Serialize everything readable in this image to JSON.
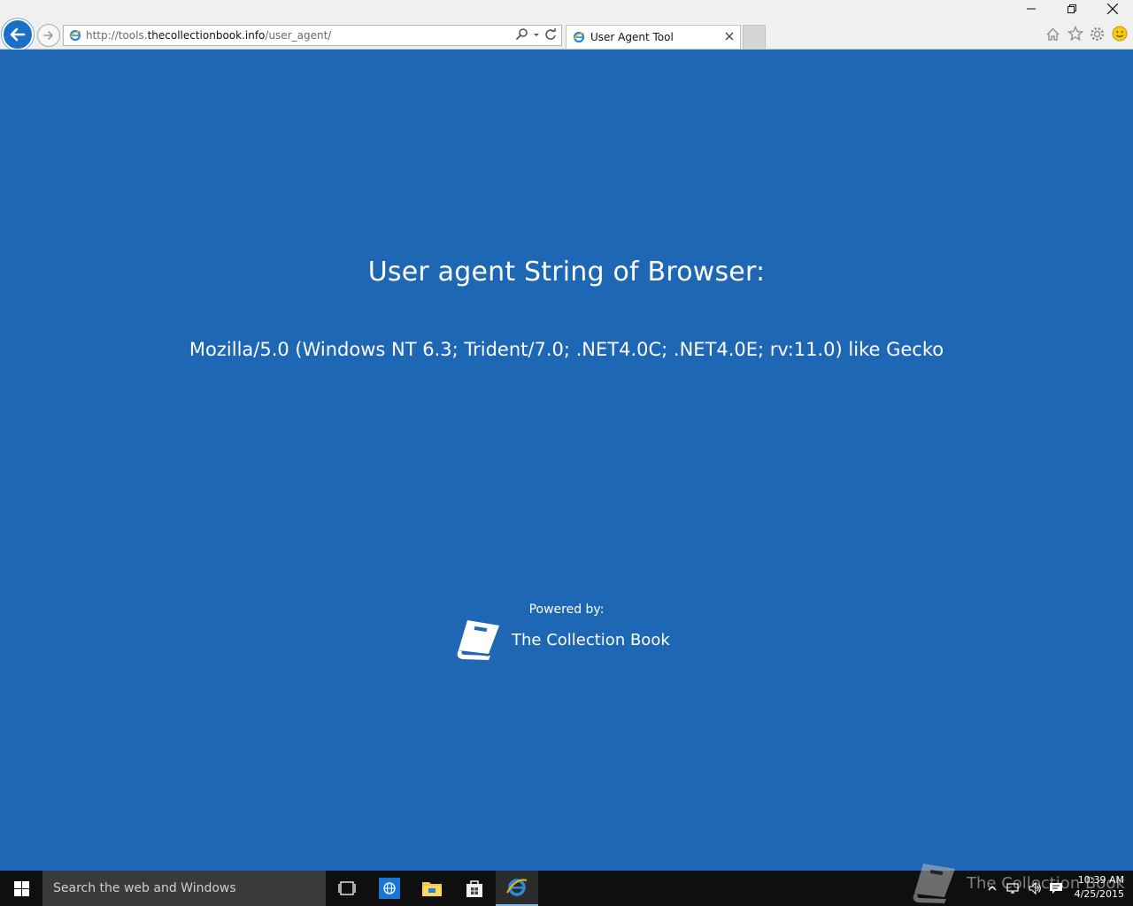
{
  "browser": {
    "address": {
      "protocol": "http://tools.",
      "domain": "thecollectionbook.info",
      "path": "/user_agent/"
    },
    "tab": {
      "title": "User Agent Tool"
    }
  },
  "page": {
    "heading": "User agent String of Browser:",
    "user_agent": "Mozilla/5.0 (Windows NT 6.3; Trident/7.0; .NET4.0C; .NET4.0E; rv:11.0) like Gecko",
    "powered_label": "Powered by:",
    "brand_name": "The Collection Book"
  },
  "taskbar": {
    "search_placeholder": "Search the web and Windows",
    "watermark": "The Collection Book",
    "time": "10:39 AM",
    "date": "4/25/2015"
  },
  "colors": {
    "page_background": "#1e67b4",
    "taskbar": "#0f0f0f",
    "ie_blue": "#1b6fc7"
  }
}
